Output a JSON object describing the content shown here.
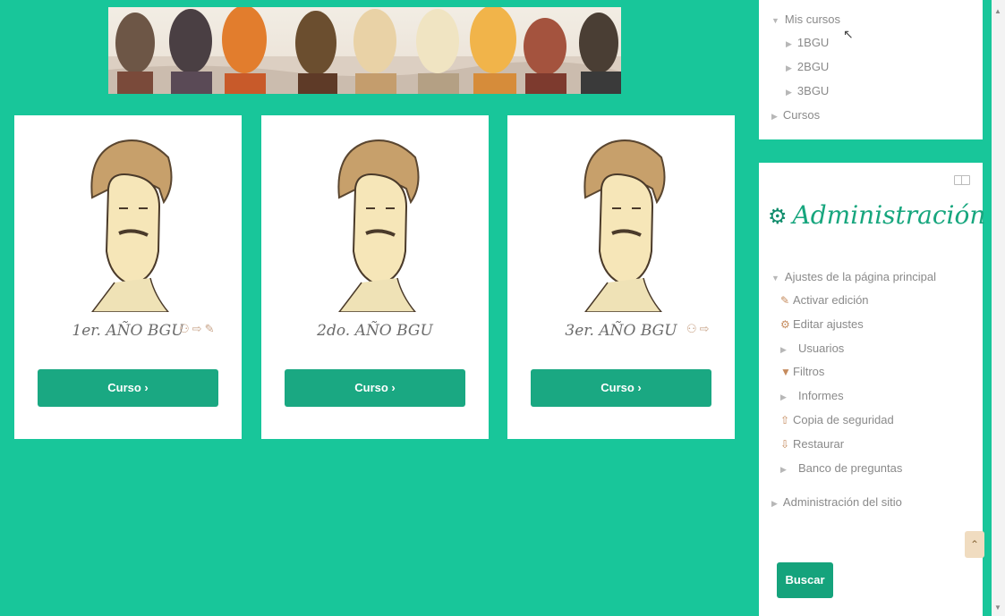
{
  "nav": {
    "my_courses": "Mis cursos",
    "courses": [
      "1BGU",
      "2BGU",
      "3BGU"
    ],
    "all_courses": "Cursos"
  },
  "admin": {
    "title": "Administración",
    "section": "Ajustes de la página principal",
    "items": [
      {
        "label": "Activar edición",
        "icon": "pencil-icon"
      },
      {
        "label": "Editar ajustes",
        "icon": "gear-icon"
      },
      {
        "label": "Usuarios",
        "icon": "caret-right-icon"
      },
      {
        "label": "Filtros",
        "icon": "filter-icon"
      },
      {
        "label": "Informes",
        "icon": "caret-right-icon"
      },
      {
        "label": "Copia de seguridad",
        "icon": "upload-icon"
      },
      {
        "label": "Restaurar",
        "icon": "download-icon"
      },
      {
        "label": "Banco de preguntas",
        "icon": "caret-right-icon"
      }
    ],
    "site_admin": "Administración del sitio",
    "search_button": "Buscar"
  },
  "cards": [
    {
      "title": "1er. AÑO BGU",
      "button": "Curso ›"
    },
    {
      "title": "2do. AÑO BGU",
      "button": "Curso ›"
    },
    {
      "title": "3er. AÑO BGU",
      "button": "Curso ›"
    }
  ],
  "colors": {
    "background": "#18c69a",
    "button": "#1aa882",
    "accent": "#17a67e"
  }
}
